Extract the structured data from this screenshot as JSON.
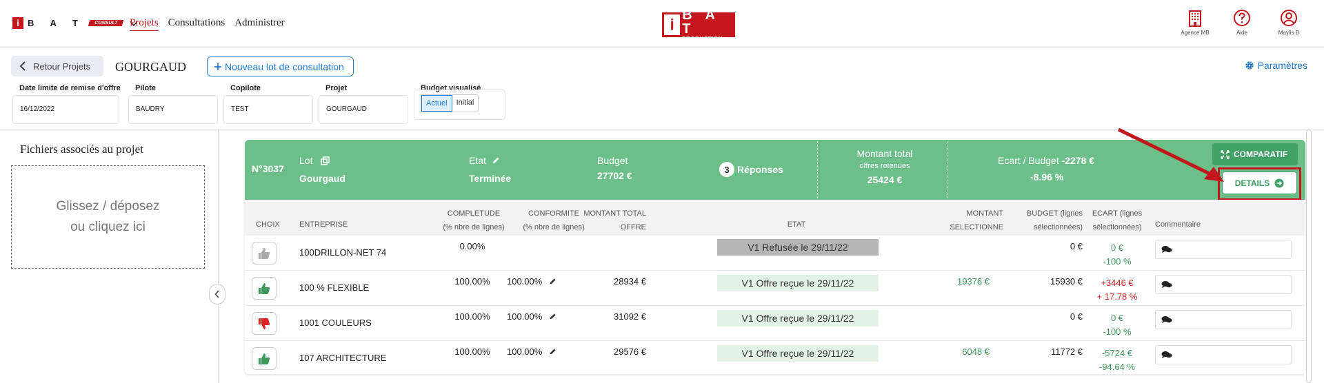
{
  "nav": {
    "logo_i": "i",
    "logo_bat": "B A T",
    "logo_consult": "CONSULT",
    "links": [
      "Projets",
      "Consultations",
      "Administrer"
    ],
    "center_logo_i": "i",
    "center_logo_bat": "B A T",
    "center_logo_prod": "PRODUCTION",
    "icons": [
      {
        "label": "Agence MB",
        "icon": "building-icon"
      },
      {
        "label": "Aide",
        "icon": "help-icon"
      },
      {
        "label": "Maylis B",
        "icon": "user-icon"
      }
    ]
  },
  "header": {
    "back_label": "Retour Projets",
    "title": "GOURGAUD",
    "new_lot_label": "Nouveau lot de consultation",
    "params_label": "Paramètres"
  },
  "fields": {
    "date_label": "Date limite de remise d'offre",
    "date_value": "16/12/2022",
    "pilote_label": "Pilote",
    "pilote_value": "BAUDRY",
    "copilote_label": "Copilote",
    "copilote_value": "TEST",
    "projet_label": "Projet",
    "projet_value": "GOURGAUD",
    "budget_label": "Budget visualisé",
    "budget_options": [
      "Actuel",
      "Initial"
    ]
  },
  "sidebar": {
    "title": "Fichiers associés au projet",
    "dropzone_line1": "Glissez / déposez",
    "dropzone_line2": "ou cliquez ici"
  },
  "lot": {
    "number": "N°3037",
    "lot_label": "Lot",
    "lot_name": "Gourgaud",
    "etat_label": "Etat",
    "etat_value": "Terminée",
    "budget_label": "Budget",
    "budget_value": "27702 €",
    "responses_count": "3",
    "responses_label": "Réponses",
    "montant_label": "Montant total",
    "montant_sub": "offres retenues",
    "montant_value": "25424 €",
    "ecart_label": "Ecart / Budget",
    "ecart_value": "-2278 €",
    "ecart_pct": "-8.96 %",
    "comparatif_label": "COMPARATIF",
    "details_label": "DETAILS"
  },
  "table": {
    "headers": {
      "choix": "CHOIX",
      "entreprise": "ENTREPRISE",
      "completude1": "COMPLETUDE",
      "completude2": "(% nbre de lignes)",
      "conformite1": "CONFORMITE",
      "conformite2": "(% nbre de lignes)",
      "montant1": "MONTANT TOTAL",
      "montant2": "OFFRE",
      "etat": "ETAT",
      "selectionne1": "MONTANT",
      "selectionne2": "SELECTIONNE",
      "budget1": "BUDGET (lignes",
      "budget2": "sélectionnées)",
      "ecart1": "ECART (lignes",
      "ecart2": "sélectionnées)",
      "commentaire": "Commentaire"
    },
    "rows": [
      {
        "choice": "neutral",
        "entreprise": "100DRILLON-NET 74",
        "completude": "0.00%",
        "conformite": "",
        "montant": "",
        "etat": "V1 Refusée le 29/11/22",
        "etat_style": "grey",
        "selectionne": "",
        "budget": "0 €",
        "ecart1": "0 €",
        "ecart2": "-100 %",
        "ecart_color": "green"
      },
      {
        "choice": "up",
        "entreprise": "100 % FLEXIBLE",
        "completude": "100.00%",
        "conformite": "100.00%",
        "montant": "28934 €",
        "etat": "V1 Offre reçue le 29/11/22",
        "etat_style": "green",
        "selectionne": "19376 €",
        "budget": "15930 €",
        "ecart1": "+3446 €",
        "ecart2": "+ 17.78 %",
        "ecart_color": "red"
      },
      {
        "choice": "down",
        "entreprise": "1001 COULEURS",
        "completude": "100.00%",
        "conformite": "100.00%",
        "montant": "31092 €",
        "etat": "V1 Offre reçue le 29/11/22",
        "etat_style": "green",
        "selectionne": "",
        "budget": "0 €",
        "ecart1": "0 €",
        "ecart2": "-100 %",
        "ecart_color": "green"
      },
      {
        "choice": "up",
        "entreprise": "107 ARCHITECTURE",
        "completude": "100.00%",
        "conformite": "100.00%",
        "montant": "29576 €",
        "etat": "V1 Offre reçue le 29/11/22",
        "etat_style": "green",
        "selectionne": "6048 €",
        "budget": "11772 €",
        "ecart1": "-5724 €",
        "ecart2": "-94.64 %",
        "ecart_color": "green"
      }
    ]
  },
  "colors": {
    "brand_red": "#c4161c",
    "lot_green": "#6dbf8a",
    "accent_blue": "#1f7ad1"
  }
}
